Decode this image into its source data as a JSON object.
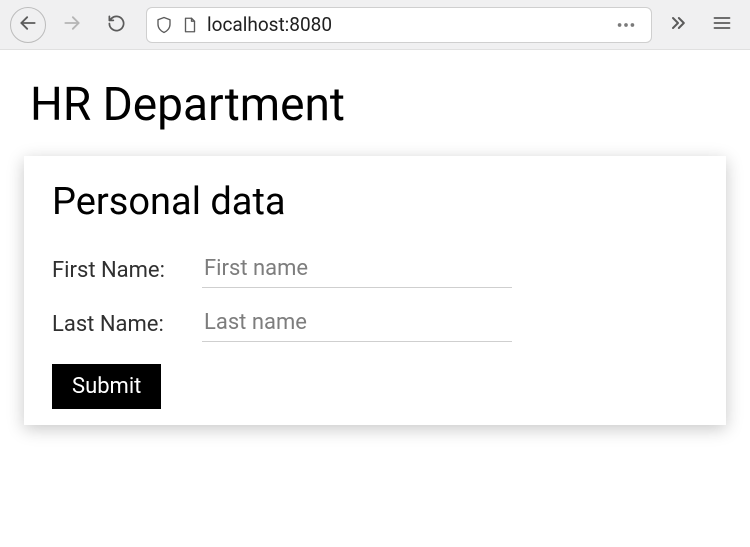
{
  "toolbar": {
    "url": "localhost:8080"
  },
  "page": {
    "title": "HR Department",
    "card_title": "Personal data",
    "first_name_label": "First Name:",
    "first_name_placeholder": "First name",
    "first_name_value": "",
    "last_name_label": "Last Name:",
    "last_name_placeholder": "Last name",
    "last_name_value": "",
    "submit_label": "Submit"
  }
}
